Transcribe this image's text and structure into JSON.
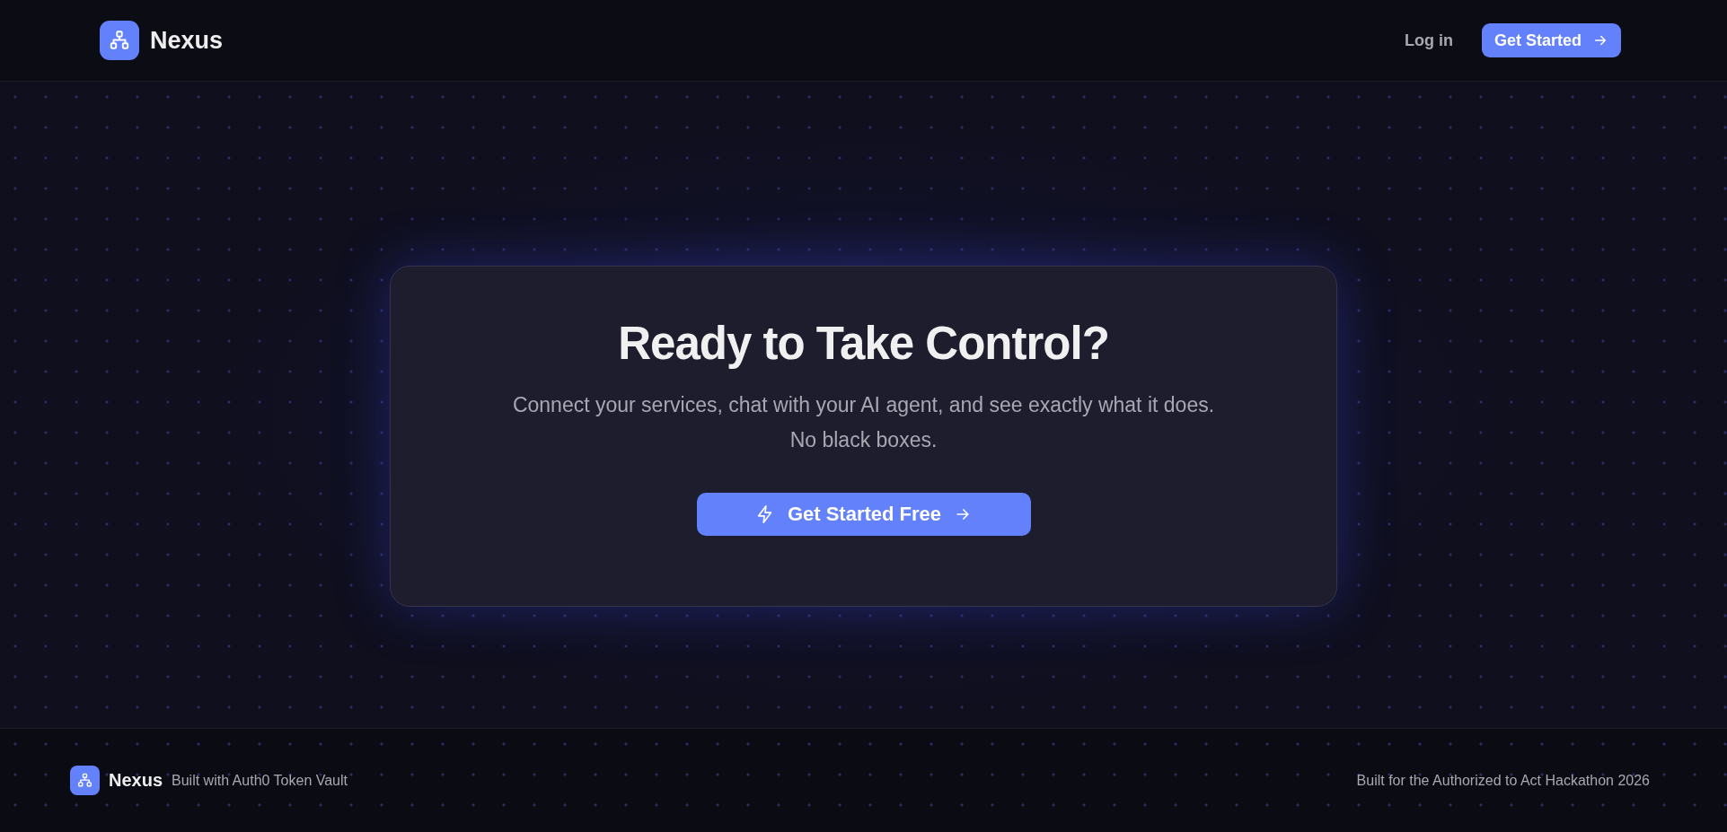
{
  "header": {
    "brand": "Nexus",
    "nav": [
      {
        "kind": "link",
        "label": "Log in"
      },
      {
        "kind": "primary",
        "label": "Get Started"
      }
    ]
  },
  "cta": {
    "title": "Ready to Take Control?",
    "lines": [
      "Connect your services, chat with your AI agent, and see exactly what it does.",
      "No black boxes."
    ],
    "button": {
      "label": "Get Started Free"
    }
  },
  "footer": {
    "brand": "Nexus",
    "tagline": "Built with Auth0 Token Vault",
    "credit": "Built for the Authorized to Act Hackathon 2026"
  }
}
